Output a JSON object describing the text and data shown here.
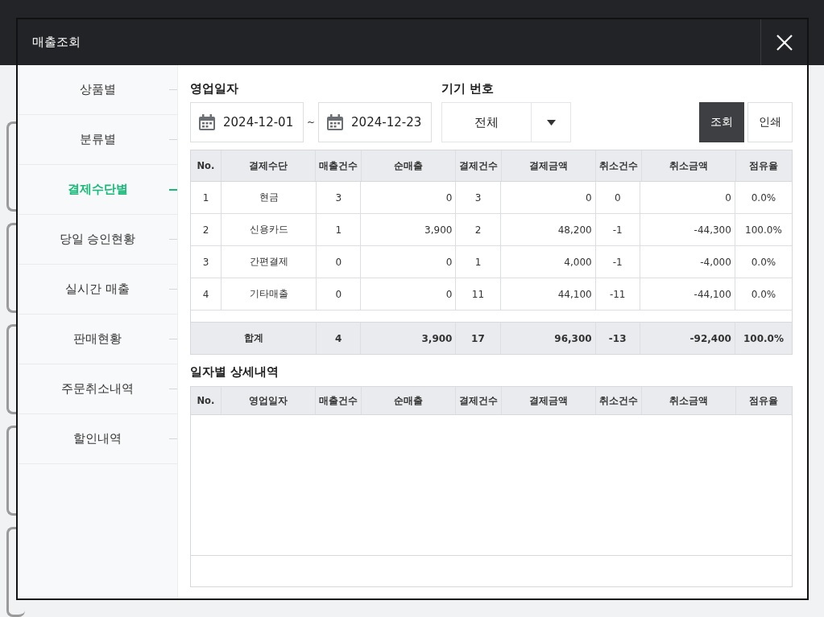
{
  "window": {
    "title": "매출조회"
  },
  "sidebar": {
    "items": [
      {
        "label": "상품별",
        "selected": false
      },
      {
        "label": "분류별",
        "selected": false
      },
      {
        "label": "결제수단별",
        "selected": true
      },
      {
        "label": "당일 승인현황",
        "selected": false
      },
      {
        "label": "실시간 매출",
        "selected": false
      },
      {
        "label": "판매현황",
        "selected": false
      },
      {
        "label": "주문취소내역",
        "selected": false
      },
      {
        "label": "할인내역",
        "selected": false
      }
    ]
  },
  "filters": {
    "date_label": "영업일자",
    "start_date": "2024-12-01",
    "separator": "~",
    "end_date": "2024-12-23",
    "device_label": "기기 번호",
    "device_value": "전체"
  },
  "buttons": [
    {
      "label": "조회",
      "kind": "primary"
    },
    {
      "label": "인쇄",
      "kind": "secondary"
    }
  ],
  "summary_table": {
    "columns": [
      "No.",
      "결제수단",
      "매출건수",
      "순매출",
      "결제건수",
      "결제금액",
      "취소건수",
      "취소금액",
      "점유율"
    ],
    "rows": [
      [
        "1",
        "현금",
        "3",
        "0",
        "3",
        "0",
        "0",
        "0",
        "0.0%"
      ],
      [
        "2",
        "신용카드",
        "1",
        "3,900",
        "2",
        "48,200",
        "-1",
        "-44,300",
        "100.0%"
      ],
      [
        "3",
        "간편결제",
        "0",
        "0",
        "1",
        "4,000",
        "-1",
        "-4,000",
        "0.0%"
      ],
      [
        "4",
        "기타매출",
        "0",
        "0",
        "11",
        "44,100",
        "-11",
        "-44,100",
        "0.0%"
      ]
    ],
    "total": {
      "label": "합계",
      "values": [
        "4",
        "3,900",
        "17",
        "96,300",
        "-13",
        "-92,400",
        "100.0%"
      ]
    }
  },
  "detail_table": {
    "title": "일자별 상세내역",
    "columns": [
      "No.",
      "영업일자",
      "매출건수",
      "순매출",
      "결제건수",
      "결제금액",
      "취소건수",
      "취소금액",
      "점유율"
    ]
  }
}
